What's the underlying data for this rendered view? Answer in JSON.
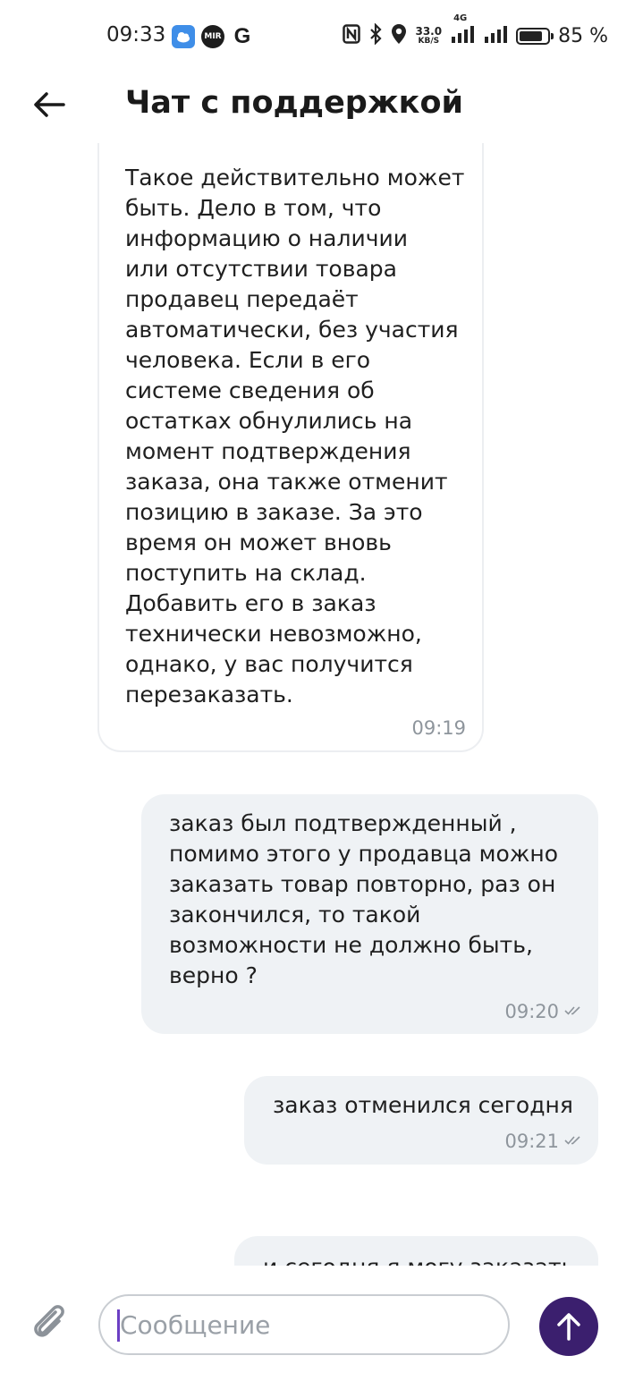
{
  "status_bar": {
    "time": "09:33",
    "network_speed": "33.0",
    "network_unit": "KB/S",
    "network_type": "4G",
    "battery": "85 %",
    "battery_level": 0.85,
    "icons": [
      "weather-icon",
      "mir-icon",
      "google-icon",
      "nfc-icon",
      "bluetooth-icon",
      "location-icon",
      "signal-icon",
      "signal-icon",
      "battery-icon"
    ]
  },
  "header": {
    "title": "Чат с поддержкой",
    "back_icon": "arrow-left-icon"
  },
  "messages": [
    {
      "direction": "incoming",
      "text": "Такое действительно может\nбыть. Дело в том, что\nинформацию о наличии\nили отсутствии товара\nпродавец передаёт\nавтоматически, без участия\nчеловека. Если в его\nсистеме сведения об\nостатках обнулились на\nмомент подтверждения\nзаказа, она также отменит\nпозицию в заказе. За это\nвремя он может вновь\nпоступить на склад.\nДобавить его в заказ\nтехнически невозможно,\nоднако, у вас получится\nперезаказать.",
      "time": "09:19"
    },
    {
      "direction": "outgoing",
      "text": "заказ был подтвержденный ,\nпомимо этого у продавца можно\nзаказать товар повторно, раз он\nзакончился, то такой\nвозможности не должно быть,\nверно ?",
      "time": "09:20",
      "status": "read"
    },
    {
      "direction": "outgoing",
      "text": "заказ отменился сегодня",
      "time": "09:21",
      "status": "read"
    },
    {
      "direction": "outgoing",
      "text": "и сегодня я могу заказать",
      "time": "",
      "status": ""
    }
  ],
  "composer": {
    "placeholder": "Сообщение",
    "value": "",
    "attach_icon": "paperclip-icon",
    "send_icon": "arrow-up-icon",
    "accent": "#3b1f6e"
  }
}
